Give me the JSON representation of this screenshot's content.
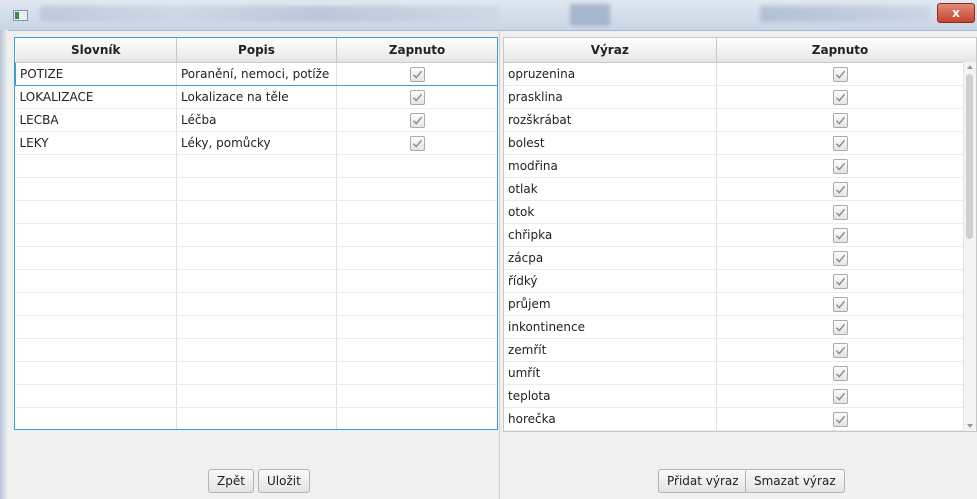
{
  "window": {
    "close_glyph": "x"
  },
  "left_table": {
    "columns": [
      "Slovník",
      "Popis",
      "Zapnuto"
    ],
    "rows": [
      {
        "slovnik": "POTIZE",
        "popis": "Poranění, nemoci, potíže",
        "zapnuto": true
      },
      {
        "slovnik": "LOKALIZACE",
        "popis": "Lokalizace na těle",
        "zapnuto": true
      },
      {
        "slovnik": "LECBA",
        "popis": "Léčba",
        "zapnuto": true
      },
      {
        "slovnik": "LEKY",
        "popis": "Léky, pomůcky",
        "zapnuto": true
      }
    ]
  },
  "right_table": {
    "columns": [
      "Výraz",
      "Zapnuto"
    ],
    "rows": [
      {
        "vyraz": "opruzenina",
        "zapnuto": true
      },
      {
        "vyraz": "prasklina",
        "zapnuto": true
      },
      {
        "vyraz": "rozškrábat",
        "zapnuto": true
      },
      {
        "vyraz": "bolest",
        "zapnuto": true
      },
      {
        "vyraz": "modřina",
        "zapnuto": true
      },
      {
        "vyraz": "otlak",
        "zapnuto": true
      },
      {
        "vyraz": "otok",
        "zapnuto": true
      },
      {
        "vyraz": "chřipka",
        "zapnuto": true
      },
      {
        "vyraz": "zácpa",
        "zapnuto": true
      },
      {
        "vyraz": "řídký",
        "zapnuto": true
      },
      {
        "vyraz": "průjem",
        "zapnuto": true
      },
      {
        "vyraz": "inkontinence",
        "zapnuto": true
      },
      {
        "vyraz": "zemřít",
        "zapnuto": true
      },
      {
        "vyraz": "umřít",
        "zapnuto": true
      },
      {
        "vyraz": "teplota",
        "zapnuto": true
      },
      {
        "vyraz": "horečka",
        "zapnuto": true
      }
    ]
  },
  "buttons": {
    "back": "Zpět",
    "save": "Uložit",
    "add_term": "Přidat výraz",
    "delete_term": "Smazat výraz"
  },
  "colors": {
    "accent": "#3a9fd8",
    "close": "#c7412d"
  }
}
